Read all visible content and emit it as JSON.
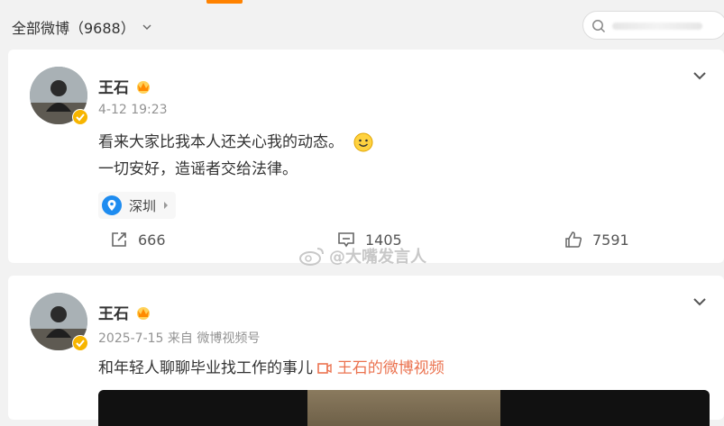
{
  "filter": {
    "label": "全部微博（9688）"
  },
  "search": {
    "placeholder": ""
  },
  "colors": {
    "accent": "#ff8200",
    "link": "#eb7350",
    "verified": "#f7b500"
  },
  "posts": [
    {
      "author": "王石",
      "time": "4-12 19:23",
      "lines": [
        "看来大家比我本人还关心我的动态。",
        "一切安好，造谣者交给法律。"
      ],
      "location": "深圳",
      "watermark": "@大嘴发言人",
      "actions": {
        "repost": "666",
        "comment": "1405",
        "like": "7591"
      }
    },
    {
      "author": "王石",
      "time": "2025-7-15",
      "source": "来自 微博视频号",
      "text": "和年轻人聊聊毕业找工作的事儿",
      "video_link": "王石的微博视频"
    }
  ]
}
